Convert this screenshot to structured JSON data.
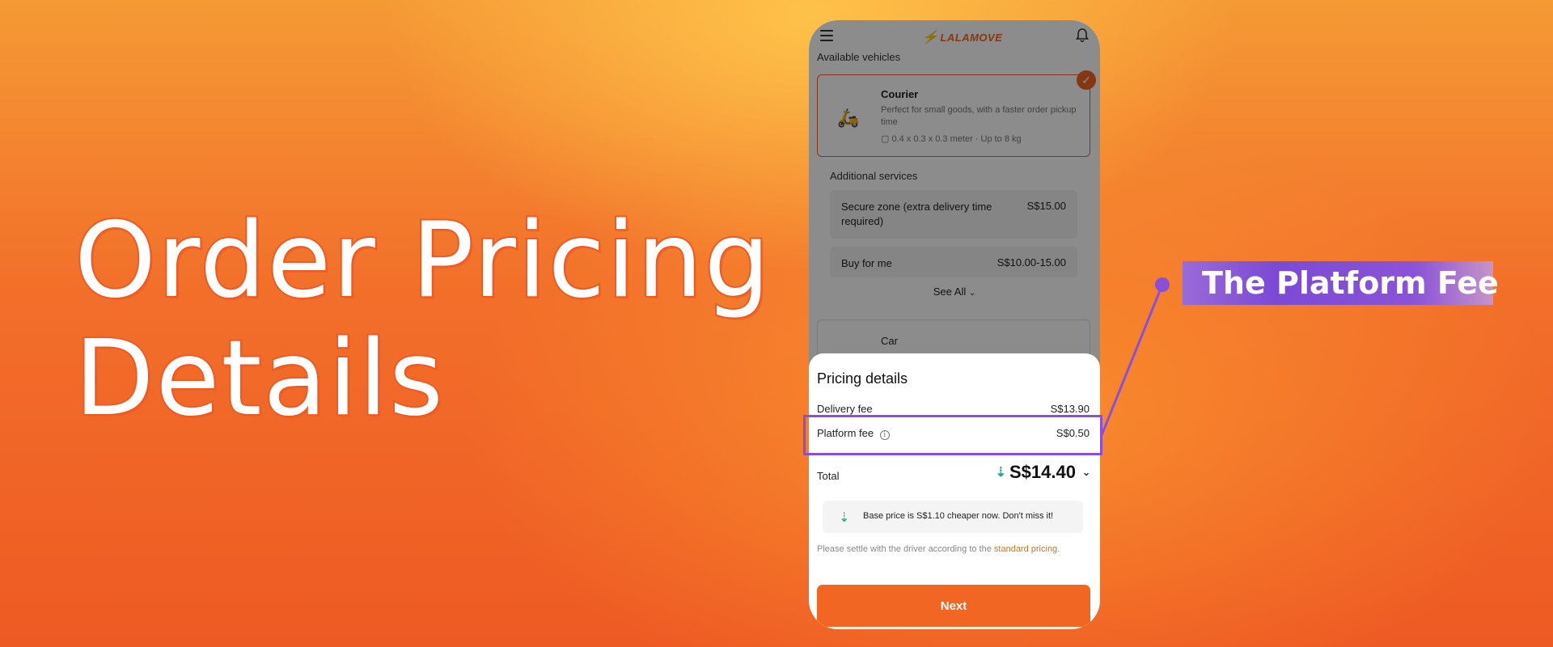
{
  "hero": {
    "line1": "Order Pricing",
    "line2": "Details"
  },
  "app": {
    "brand": "LALAMOVE",
    "available_label": "Available vehicles",
    "vehicle": {
      "name": "Courier",
      "description": "Perfect for small goods, with a faster order pickup time",
      "dims": "0.4 x 0.3 x 0.3 meter · Up to 8 kg"
    },
    "additional_label": "Additional services",
    "services": [
      {
        "name": "Secure zone (extra delivery time required)",
        "price": "S$15.00"
      },
      {
        "name": "Buy for me",
        "price": "S$10.00-15.00"
      }
    ],
    "see_all": "See All",
    "vehicle2_name": "Car"
  },
  "pricing": {
    "title": "Pricing details",
    "delivery_label": "Delivery fee",
    "delivery_value": "S$13.90",
    "platform_label": "Platform fee",
    "platform_value": "S$0.50",
    "total_label": "Total",
    "total_value": "S$14.40",
    "promo": "Base price is S$1.10 cheaper now. Don't miss it!",
    "settle_text": "Please settle with the driver according to the",
    "settle_link": "standard pricing",
    "settle_end": ".",
    "next_label": "Next"
  },
  "callout": {
    "label": "The Platform Fee"
  },
  "colors": {
    "brand": "#f16622",
    "highlight": "#8a4fd8",
    "saving": "#1aa78a"
  },
  "icons": [
    "menu-icon",
    "bell-icon",
    "check-icon",
    "courier-icon",
    "box-icon",
    "chevron-down-icon",
    "info-icon",
    "down-arrow-icon"
  ]
}
